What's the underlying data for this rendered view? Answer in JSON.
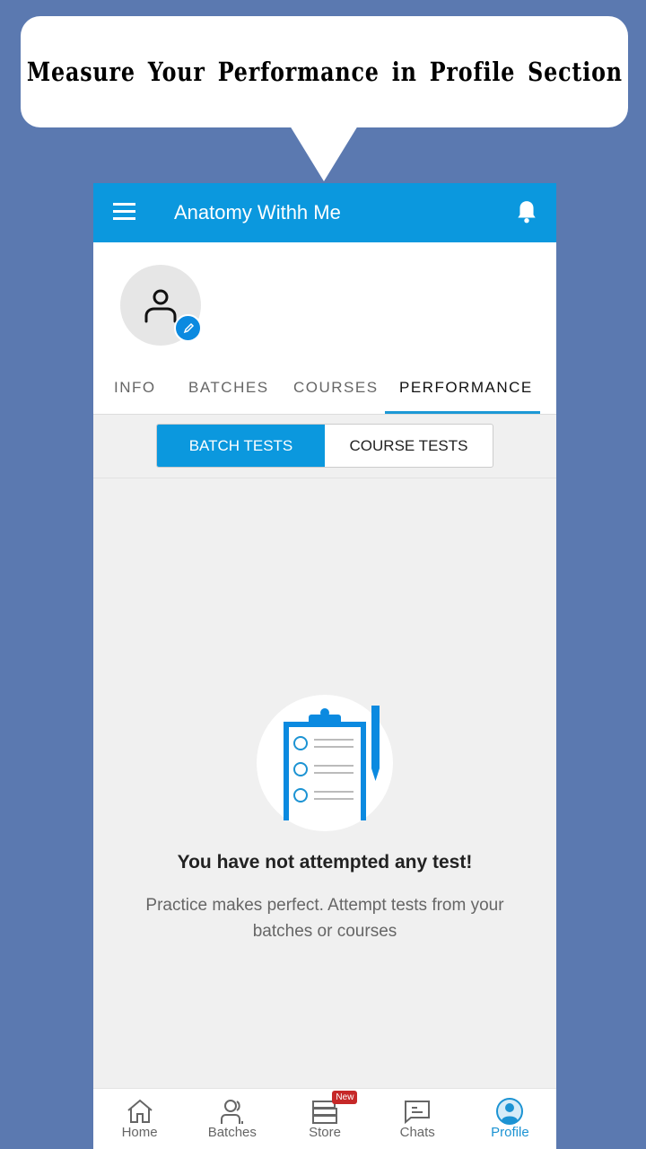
{
  "callout": {
    "title": "Measure Your Performance in Profile Section"
  },
  "appbar": {
    "title": "Anatomy Withh Me",
    "menu_icon": "hamburger-icon",
    "bell_icon": "bell-icon"
  },
  "profile": {
    "tabs": [
      {
        "label": "INFO"
      },
      {
        "label": "BATCHES"
      },
      {
        "label": "COURSES"
      },
      {
        "label": "PERFORMANCE",
        "active": true
      }
    ]
  },
  "segment": {
    "batch": "BATCH TESTS",
    "course": "COURSE TESTS",
    "selected": "BATCH TESTS"
  },
  "empty": {
    "title": "You have not attempted any test!",
    "subtitle": "Practice makes perfect. Attempt tests from your batches or courses"
  },
  "nav": {
    "items": [
      {
        "label": "Home"
      },
      {
        "label": "Batches"
      },
      {
        "label": "Store",
        "badge": "New"
      },
      {
        "label": "Chats"
      },
      {
        "label": "Profile",
        "active": true
      }
    ]
  },
  "colors": {
    "accent": "#0b98de",
    "background": "#5b79b0",
    "badge": "#c62828"
  }
}
